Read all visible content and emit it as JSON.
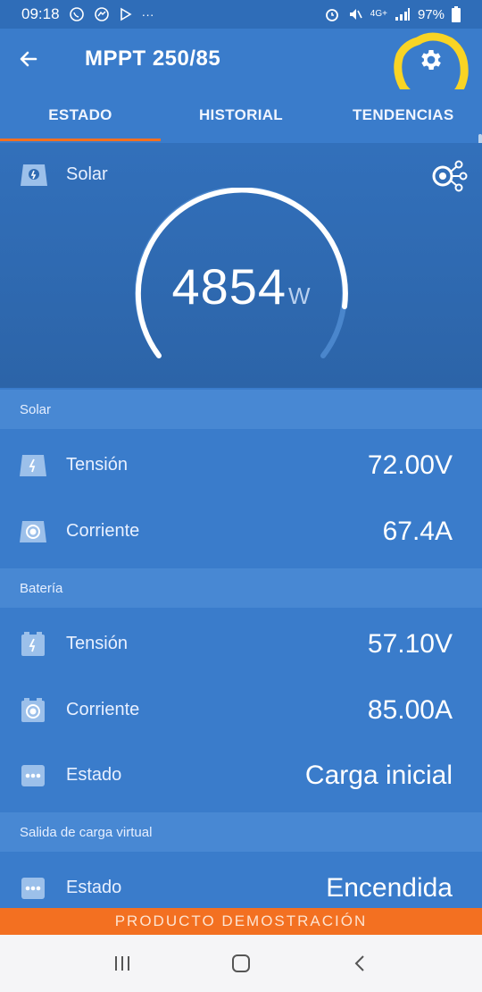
{
  "status_bar": {
    "time": "09:18",
    "left_icons": [
      "whatsapp-icon",
      "messenger-icon",
      "play-store-icon"
    ],
    "more": "···",
    "network": "4G+",
    "battery": "97%"
  },
  "app_bar": {
    "title": "MPPT 250/85",
    "highlight_color": "#f9d424"
  },
  "tabs": [
    {
      "label": "ESTADO",
      "active": true
    },
    {
      "label": "HISTORIAL",
      "active": false
    },
    {
      "label": "TENDENCIAS",
      "active": false
    }
  ],
  "hero": {
    "label": "Solar",
    "power_value": "4854",
    "power_unit": "W"
  },
  "sections": {
    "solar": {
      "header": "Solar",
      "rows": [
        {
          "label": "Tensión",
          "value": "72.00V"
        },
        {
          "label": "Corriente",
          "value": "67.4A"
        }
      ]
    },
    "battery": {
      "header": "Batería",
      "rows": [
        {
          "label": "Tensión",
          "value": "57.10V"
        },
        {
          "label": "Corriente",
          "value": "85.00A"
        },
        {
          "label": "Estado",
          "value": "Carga inicial"
        }
      ]
    },
    "virtual_load": {
      "header": "Salida de carga virtual",
      "rows": [
        {
          "label": "Estado",
          "value": "Encendida"
        }
      ]
    }
  },
  "demo_banner": "PRODUCTO DEMOSTRACIÓN",
  "colors": {
    "primary": "#3a7ccb",
    "accent": "#f37021",
    "section_header": "#4888d3"
  }
}
